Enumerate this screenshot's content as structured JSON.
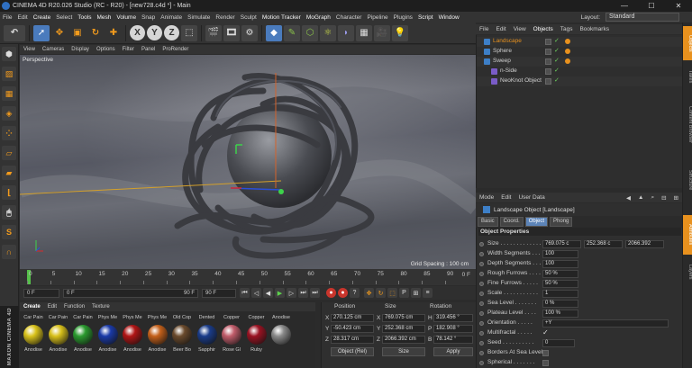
{
  "window": {
    "title": "CINEMA 4D R20.026 Studio (RC - R20) - [new728.c4d *] - Main",
    "minimize": "—",
    "maximize": "☐",
    "close": "✕"
  },
  "menubar": {
    "items": [
      "File",
      "Edit",
      "Create",
      "Select",
      "Tools",
      "Mesh",
      "Volume",
      "Snap",
      "Animate",
      "Simulate",
      "Render",
      "Sculpt",
      "Motion Tracker",
      "MoGraph",
      "Character",
      "Pipeline",
      "Plugins",
      "Script",
      "Window"
    ],
    "layout_label": "Layout:",
    "layout_value": "Standard"
  },
  "toolbar": {
    "x_label": "X",
    "y_label": "Y",
    "z_label": "Z"
  },
  "viewport": {
    "menu": [
      "View",
      "Cameras",
      "Display",
      "Options",
      "Filter",
      "Panel",
      "ProRender"
    ],
    "label": "Perspective",
    "grid_spacing": "Grid Spacing : 100 cm"
  },
  "timeline": {
    "ticks": [
      "0",
      "5",
      "10",
      "15",
      "20",
      "25",
      "30",
      "35",
      "40",
      "45",
      "50",
      "55",
      "60",
      "65",
      "70",
      "75",
      "80",
      "85",
      "90"
    ],
    "frame_indicator": "0 F",
    "start_field": "0 F",
    "current_field": "0 F",
    "end_field_a": "90 F",
    "end_field_b": "90 F"
  },
  "materials": {
    "menu": [
      "Create",
      "Edit",
      "Function",
      "Texture"
    ],
    "items": [
      {
        "top": "Car Pain",
        "bottom": "Anodise",
        "color": "#d9c21b"
      },
      {
        "top": "Car Pain",
        "bottom": "Anodise",
        "color": "#d8c01a"
      },
      {
        "top": "Car Pain",
        "bottom": "Anodise",
        "color": "#2a9a2e"
      },
      {
        "top": "Phys Me",
        "bottom": "Anodise",
        "color": "#1a3aa8"
      },
      {
        "top": "Phys Me",
        "bottom": "Anodise",
        "color": "#b01414"
      },
      {
        "top": "Phys Me",
        "bottom": "Anodise",
        "color": "#c4601a"
      },
      {
        "top": "Old Cop",
        "bottom": "Beer Bo",
        "color": "#6a4a2c"
      },
      {
        "top": "Dented",
        "bottom": "Sapphir",
        "color": "#1a3c8a"
      },
      {
        "top": "Copper",
        "bottom": "Rose Gl",
        "color": "#c05c6a"
      },
      {
        "top": "Copper",
        "bottom": "Ruby",
        "color": "#9a1222"
      },
      {
        "top": "Anodise",
        "bottom": "",
        "color": "#8a8a8a"
      }
    ],
    "brand": "MAXON CINEMA 4D"
  },
  "coords": {
    "headers": [
      "Position",
      "Size",
      "Rotation"
    ],
    "rows": [
      {
        "axis": "X",
        "pos": "270.125 cm",
        "size_axis": "X",
        "size": "769.075 cm",
        "rot_axis": "H",
        "rot": "319.456 °"
      },
      {
        "axis": "Y",
        "pos": "-50.423 cm",
        "size_axis": "Y",
        "size": "252.368 cm",
        "rot_axis": "P",
        "rot": "182.908 °"
      },
      {
        "axis": "Z",
        "pos": "28.317 cm",
        "size_axis": "Z",
        "size": "2066.392 cm",
        "rot_axis": "B",
        "rot": "78.142 °"
      }
    ],
    "mode": "Object (Rel)",
    "size_mode": "Size",
    "apply": "Apply"
  },
  "object_manager": {
    "menu": [
      "File",
      "Edit",
      "View",
      "Objects",
      "Tags",
      "Bookmarks"
    ],
    "objects": [
      {
        "name": "Landscape",
        "color": "#e8911e",
        "tag": true,
        "indent": 0
      },
      {
        "name": "Sphere",
        "color": "#d0d0d0",
        "tag": true,
        "indent": 0
      },
      {
        "name": "Sweep",
        "color": "#d0d0d0",
        "tag": true,
        "indent": 0
      },
      {
        "name": "n-Side",
        "color": "#d0d0d0",
        "tag": false,
        "indent": 1
      },
      {
        "name": "NeoKnot Object",
        "color": "#d0d0d0",
        "tag": false,
        "indent": 1
      }
    ]
  },
  "attributes": {
    "menu": [
      "Mode",
      "Edit",
      "User Data"
    ],
    "title": "Landscape Object [Landscape]",
    "tabs": [
      "Basic",
      "Coord.",
      "Object",
      "Phong"
    ],
    "active_tab": "Object",
    "section": "Object Properties",
    "size_label": "Size . . . . . . . . . . . . .",
    "size_x": "769.075 c",
    "size_y": "252.368 c",
    "size_z": "2066.392",
    "props": [
      {
        "label": "Width Segments . . .",
        "value": "100"
      },
      {
        "label": "Depth Segments . . .",
        "value": "100"
      },
      {
        "label": "Rough Furrows . . . .",
        "value": "50 %"
      },
      {
        "label": "Fine Furrows . . . . .",
        "value": "50 %"
      },
      {
        "label": "Scale . . . . . . . . . . .",
        "value": "1"
      },
      {
        "label": "Sea Level . . . . . . .",
        "value": "0 %"
      },
      {
        "label": "Plateau Level . . . .",
        "value": "100 %"
      }
    ],
    "orientation_label": "Orientation . . . . .",
    "orientation_value": "+Y",
    "multifractal_label": "Multifractal . . . . .",
    "multifractal_value": "✓",
    "seed_label": "Seed . . . . . . . . . .",
    "seed_value": "0",
    "borders_label": "Borders At Sea Level",
    "spherical_label": "Spherical . . . . . . ."
  },
  "side_tabs": [
    "Objects",
    "Takes",
    "Content Browser",
    "Structure",
    "Attributes",
    "Layers"
  ]
}
